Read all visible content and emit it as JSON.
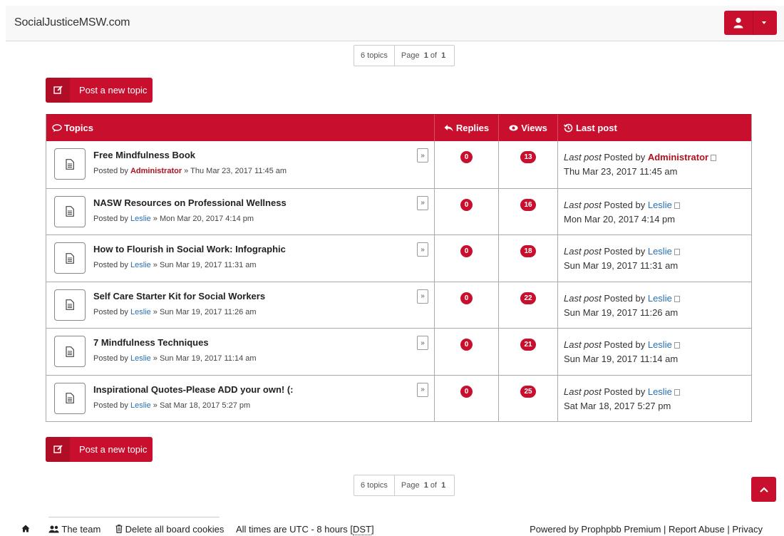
{
  "header": {
    "brand": "SocialJusticeMSW.com"
  },
  "pagination": {
    "topics_count": "6 topics",
    "page_prefix": "Page",
    "page_current": "1",
    "page_of": "of",
    "page_total": "1"
  },
  "actions": {
    "post_new_topic": "Post a new topic"
  },
  "table": {
    "headers": {
      "topics": "Topics",
      "replies": "Replies",
      "views": "Views",
      "last_post": "Last post"
    },
    "rows": [
      {
        "title": "Free Mindfulness Book",
        "posted_by_prefix": "Posted by",
        "author": "Administrator",
        "date": "» Thu Mar 23, 2017 11:45 am",
        "replies": "0",
        "views": "13",
        "last_post_label": "Last post",
        "last_post_by": "Posted by",
        "last_author": "Administrator",
        "last_date": "Thu Mar 23, 2017 11:45 am"
      },
      {
        "title": "NASW Resources on Professional Wellness",
        "posted_by_prefix": "Posted by",
        "author": "Leslie",
        "date": "» Mon Mar 20, 2017 4:14 pm",
        "replies": "0",
        "views": "16",
        "last_post_label": "Last post",
        "last_post_by": "Posted by",
        "last_author": "Leslie",
        "last_date": "Mon Mar 20, 2017 4:14 pm"
      },
      {
        "title": "How to Flourish in Social Work: Infographic",
        "posted_by_prefix": "Posted by",
        "author": "Leslie",
        "date": "» Sun Mar 19, 2017 11:31 am",
        "replies": "0",
        "views": "18",
        "last_post_label": "Last post",
        "last_post_by": "Posted by",
        "last_author": "Leslie",
        "last_date": "Sun Mar 19, 2017 11:31 am"
      },
      {
        "title": "Self Care Starter Kit for Social Workers",
        "posted_by_prefix": "Posted by",
        "author": "Leslie",
        "date": "» Sun Mar 19, 2017 11:26 am",
        "replies": "0",
        "views": "22",
        "last_post_label": "Last post",
        "last_post_by": "Posted by",
        "last_author": "Leslie",
        "last_date": "Sun Mar 19, 2017 11:26 am"
      },
      {
        "title": "7 Mindfulness Techniques",
        "posted_by_prefix": "Posted by",
        "author": "Leslie",
        "date": "» Sun Mar 19, 2017 11:14 am",
        "replies": "0",
        "views": "21",
        "last_post_label": "Last post",
        "last_post_by": "Posted by",
        "last_author": "Leslie",
        "last_date": "Sun Mar 19, 2017 11:14 am"
      },
      {
        "title": "Inspirational Quotes-Please ADD your own! (:",
        "posted_by_prefix": "Posted by",
        "author": "Leslie",
        "date": "» Sat Mar 18, 2017 5:27 pm",
        "replies": "0",
        "views": "25",
        "last_post_label": "Last post",
        "last_post_by": "Posted by",
        "last_author": "Leslie",
        "last_date": "Sat Mar 18, 2017 5:27 pm"
      }
    ]
  },
  "footer": {
    "team": "The team",
    "delete_cookies": "Delete all board cookies",
    "timezone_prefix": "All times are UTC - 8 hours [",
    "dst": "DST",
    "timezone_suffix": "]",
    "powered_by": "Powered by Prophpbb Premium | Report Abuse | Privacy"
  },
  "colors": {
    "accent": "#c8102e",
    "link": "#2a6fb3",
    "admin": "#b0101d"
  }
}
